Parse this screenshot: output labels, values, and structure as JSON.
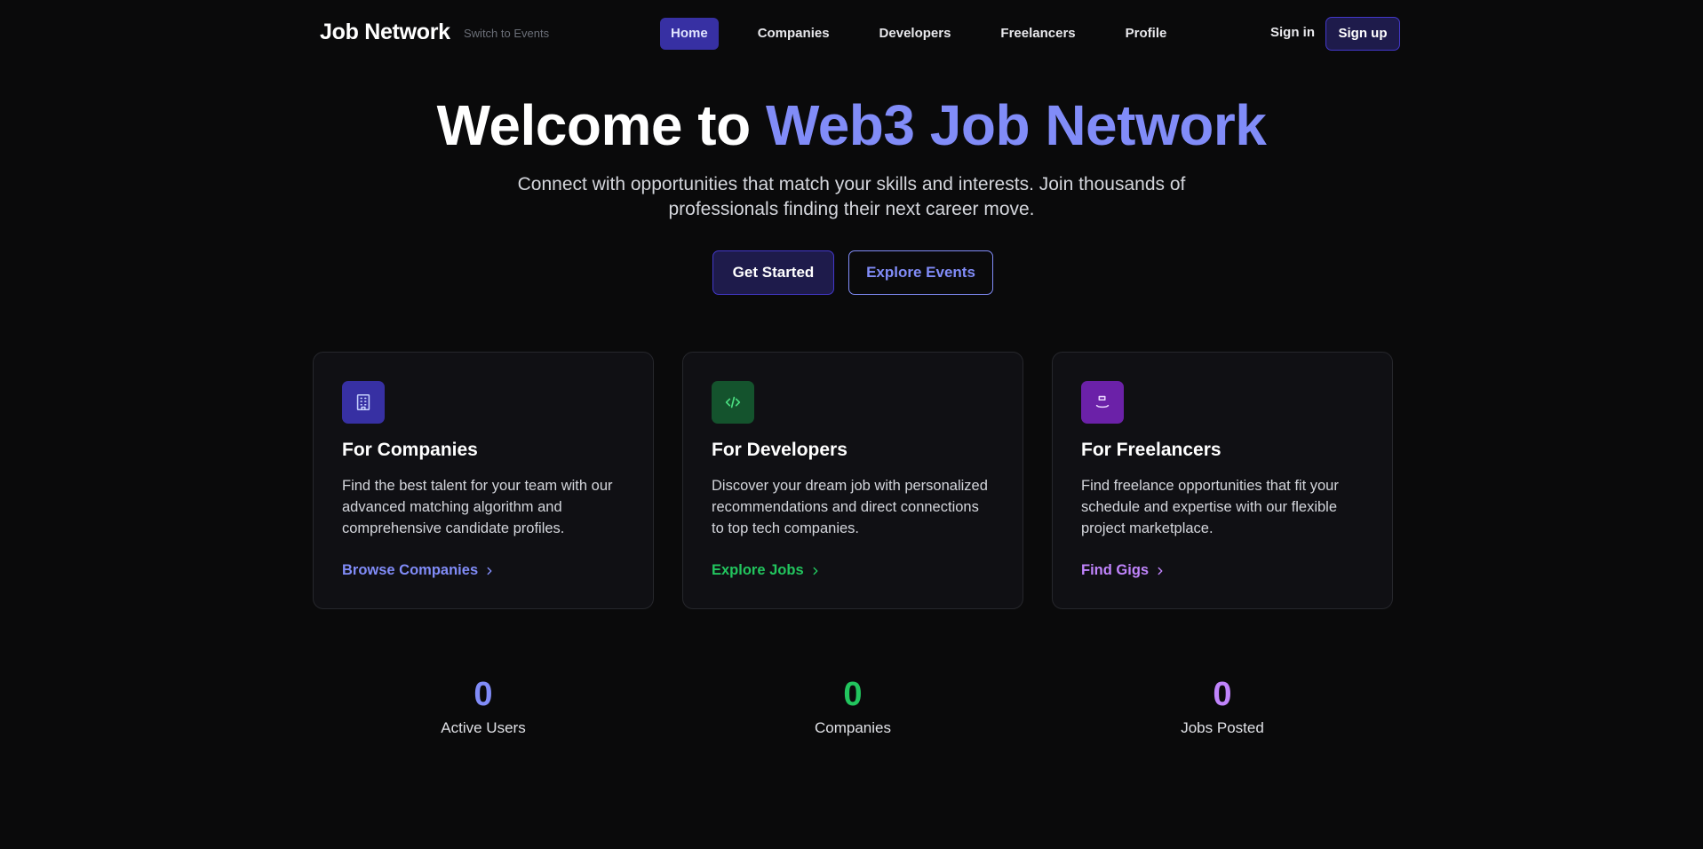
{
  "nav": {
    "brand": "Job Network",
    "switch_label": "Switch to Events",
    "links": [
      {
        "label": "Home",
        "active": true
      },
      {
        "label": "Companies",
        "active": false
      },
      {
        "label": "Developers",
        "active": false
      },
      {
        "label": "Freelancers",
        "active": false
      },
      {
        "label": "Profile",
        "active": false
      }
    ],
    "signin": "Sign in",
    "signup": "Sign up"
  },
  "hero": {
    "title_prefix": "Welcome to ",
    "title_accent": "Web3 Job Network",
    "subtitle": "Connect with opportunities that match your skills and interests. Join thousands of professionals finding their next career move.",
    "primary_cta": "Get Started",
    "secondary_cta": "Explore Events"
  },
  "cards": [
    {
      "icon": "building-icon",
      "title": "For Companies",
      "description": "Find the best talent for your team with our advanced matching algorithm and comprehensive candidate profiles.",
      "link": "Browse Companies",
      "color": "#818cf8",
      "icon_bg": "#3730a3"
    },
    {
      "icon": "code-icon",
      "title": "For Developers",
      "description": "Discover your dream job with personalized recommendations and direct connections to top tech companies.",
      "link": "Explore Jobs",
      "color": "#22c55e",
      "icon_bg": "#14532d"
    },
    {
      "icon": "briefcase-icon",
      "title": "For Freelancers",
      "description": "Find freelance opportunities that fit your schedule and expertise with our flexible project marketplace.",
      "link": "Find Gigs",
      "color": "#c084fc",
      "icon_bg": "#6b21a8"
    }
  ],
  "stats": [
    {
      "value": "0",
      "label": "Active Users",
      "color": "#818cf8"
    },
    {
      "value": "0",
      "label": "Companies",
      "color": "#22c55e"
    },
    {
      "value": "0",
      "label": "Jobs Posted",
      "color": "#c084fc"
    }
  ]
}
